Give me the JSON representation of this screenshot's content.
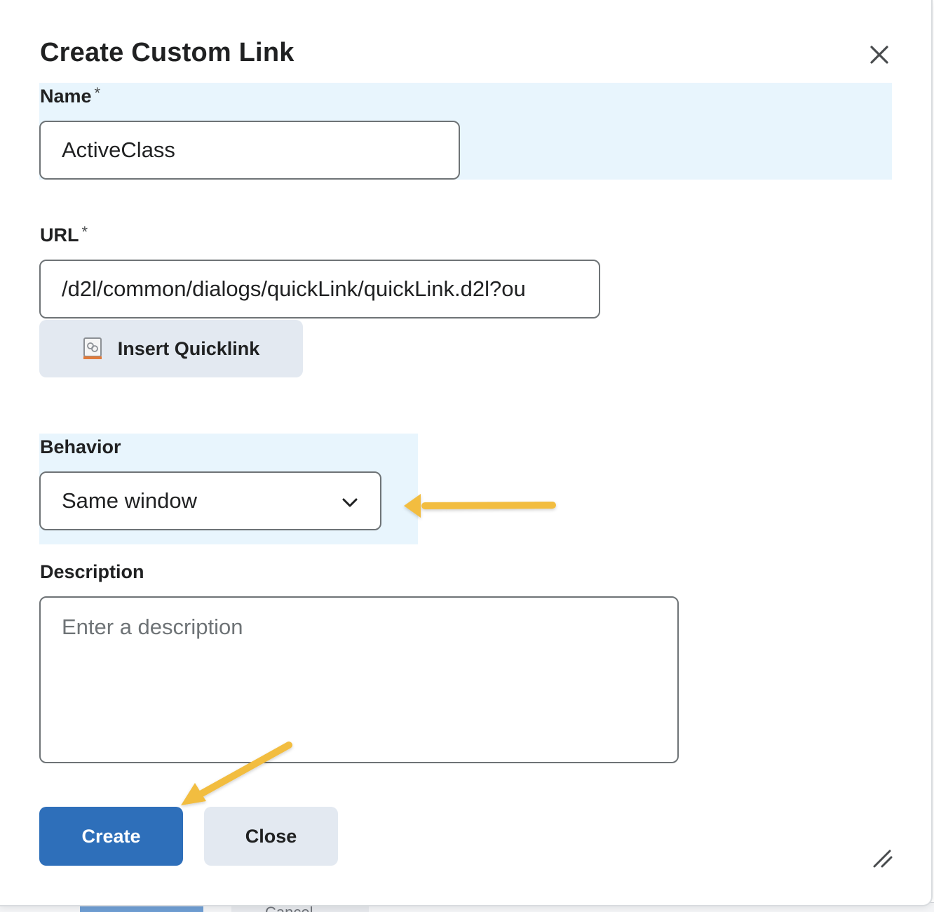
{
  "dialog": {
    "title": "Create Custom Link",
    "close_icon": "close-icon"
  },
  "name_field": {
    "label": "Name",
    "required_mark": "*",
    "value": "ActiveClass"
  },
  "url_field": {
    "label": "URL",
    "required_mark": "*",
    "value": "/d2l/common/dialogs/quickLink/quickLink.d2l?ou"
  },
  "insert_quicklink": {
    "label": "Insert Quicklink",
    "icon": "quicklink-icon"
  },
  "behavior_field": {
    "label": "Behavior",
    "selected": "Same window",
    "icon": "chevron-down-icon"
  },
  "description_field": {
    "label": "Description",
    "placeholder": "Enter a description"
  },
  "footer": {
    "create_label": "Create",
    "close_label": "Close"
  },
  "underlay": {
    "partial_text": "Cancel"
  },
  "colors": {
    "primary": "#2e6fba",
    "secondary": "#e3e9f1",
    "highlight": "#e8f5fd",
    "annotation_arrow": "#f2bd41"
  }
}
